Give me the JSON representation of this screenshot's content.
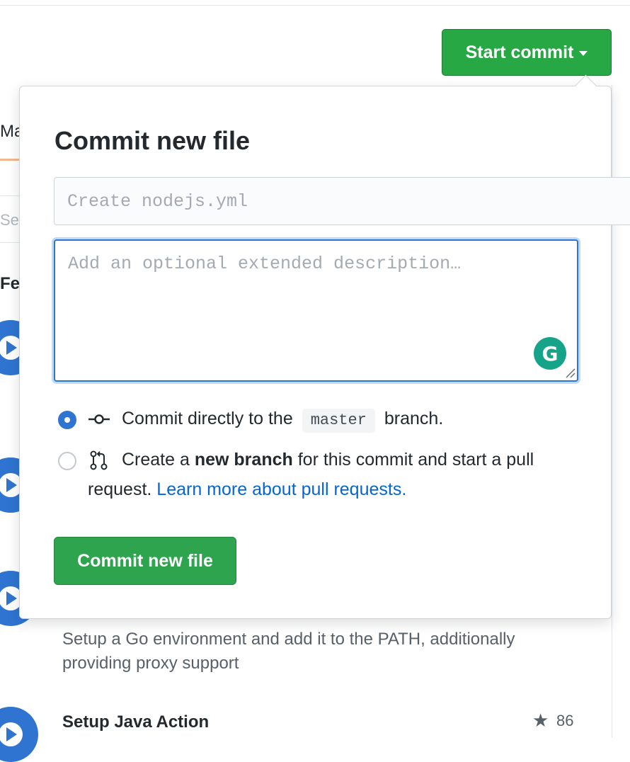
{
  "header": {
    "start_commit_label": "Start commit"
  },
  "background": {
    "tab_label": "Marketplace",
    "search_placeholder": "Search",
    "section_heading": "Featured",
    "go_description": "Setup a Go environment and add it to the PATH, additionally providing proxy support",
    "java_title": "Setup Java Action",
    "java_stars": "86"
  },
  "commit_dialog": {
    "title": "Commit new file",
    "summary_placeholder": "Create nodejs.yml",
    "description_placeholder": "Add an optional extended description…",
    "grammarly_letter": "G",
    "option_direct": {
      "prefix": "Commit directly to the",
      "branch": "master",
      "suffix": "branch.",
      "selected": true
    },
    "option_new_branch": {
      "prefix": "Create a",
      "bold": "new branch",
      "middle": "for this commit and start a pull",
      "line2": "request.",
      "link": "Learn more about pull requests.",
      "selected": false
    },
    "commit_button_label": "Commit new file"
  },
  "colors": {
    "primary_green": "#28a745",
    "focus_blue": "#2f74d0",
    "link_blue": "#0366d6",
    "grammarly_teal": "#15a38a"
  },
  "icons": {
    "commit": "git-commit-icon",
    "pull_request": "git-pull-request-icon",
    "star": "star-icon",
    "action": "play-circle-icon"
  }
}
